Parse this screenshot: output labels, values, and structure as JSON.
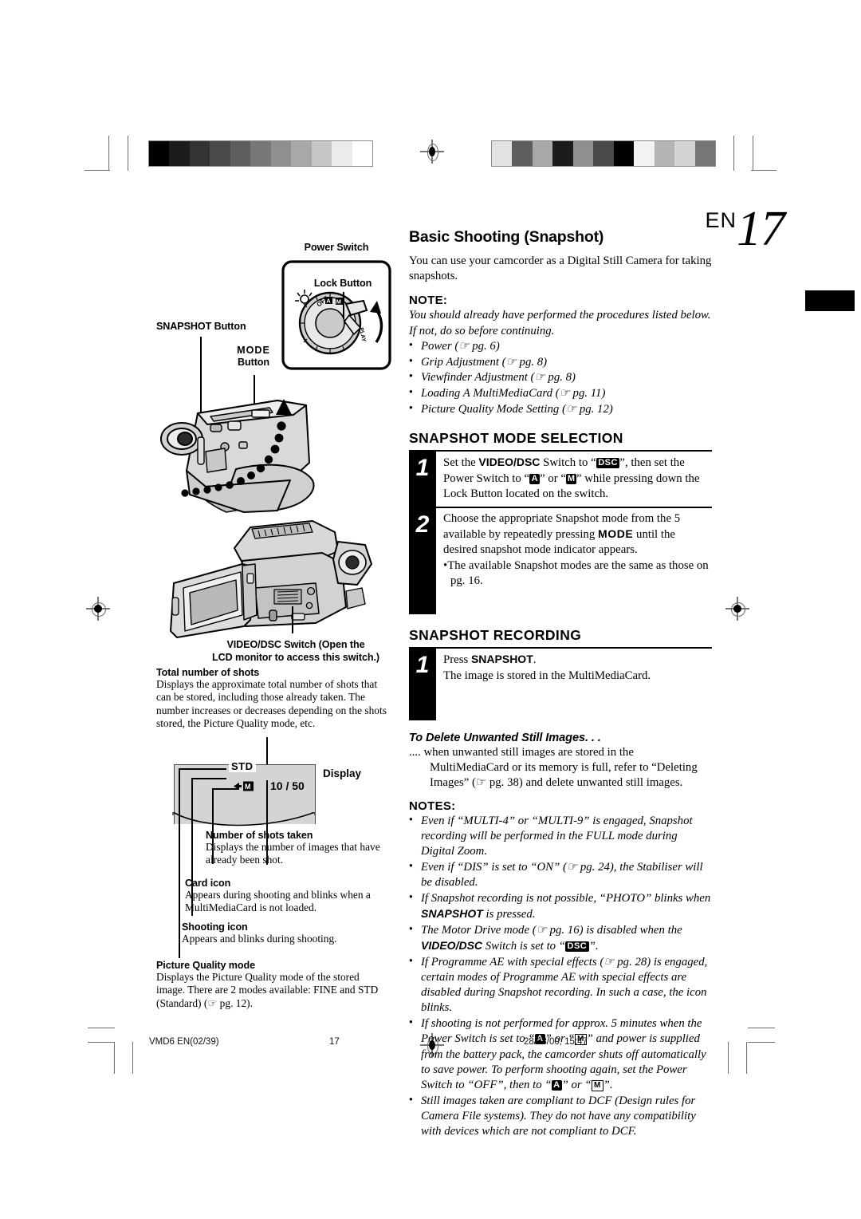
{
  "page": {
    "lang_code": "EN",
    "number": "17"
  },
  "header": {
    "title": "Basic Shooting (Snapshot)",
    "intro": "You can use your camcorder as a Digital Still Camera for taking snapshots."
  },
  "note": {
    "heading": "NOTE:",
    "body": "You should already have performed the procedures listed below. If not, do so before continuing.",
    "items": [
      "Power (☞ pg. 6)",
      "Grip Adjustment (☞ pg. 8)",
      "Viewfinder Adjustment (☞ pg. 8)",
      "Loading A MultiMediaCard (☞ pg. 11)",
      "Picture Quality Mode Setting (☞ pg. 12)"
    ]
  },
  "mode_selection": {
    "heading": "SNAPSHOT MODE SELECTION",
    "steps": [
      {
        "num": "1",
        "text_parts": [
          "Set the ",
          "VIDEO/DSC",
          " Switch to “",
          "DSC",
          "”, then set the Power Switch to “",
          "A",
          "” or “",
          "M",
          "” while pressing down the Lock Button located on the switch."
        ]
      },
      {
        "num": "2",
        "text_parts": [
          "Choose the appropriate Snapshot mode from the 5 available by repeatedly pressing ",
          "MODE",
          " until the desired snapshot mode indicator appears."
        ],
        "sub": "The available Snapshot modes are the same as those on pg. 16."
      }
    ]
  },
  "recording": {
    "heading": "SNAPSHOT RECORDING",
    "steps": [
      {
        "num": "1",
        "line1_pre": "Press ",
        "line1_bold": "SNAPSHOT",
        "line1_post": ".",
        "line2": "The image is stored in the MultiMediaCard."
      }
    ]
  },
  "delete_section": {
    "heading": "To Delete Unwanted Still Images. . .",
    "body": ".... when unwanted still images are stored in the MultiMediaCard or its memory is full, refer to “Deleting Images” (☞ pg. 38) and delete unwanted still images."
  },
  "notes": {
    "heading": "NOTES:",
    "items": [
      "Even if “MULTI-4” or “MULTI-9” is engaged, Snapshot recording will be performed in the FULL mode during Digital Zoom.",
      "Even if “DIS” is set to “ON” (☞ pg. 24), the Stabiliser will be disabled.",
      "If Snapshot recording is not possible, “PHOTO” blinks when SNAPSHOT is pressed.",
      "The Motor Drive mode (☞ pg. 16) is disabled when the VIDEO/DSC Switch is set to “DSC”.",
      "If Programme AE with special effects (☞ pg. 28) is engaged, certain modes of Programme AE with special effects are disabled during Snapshot recording. In such a case, the icon blinks.",
      "If shooting is not performed for approx. 5 minutes when the Power Switch is set to “A” or “M” and power is supplied from the battery pack, the camcorder shuts off automatically to save power. To perform shooting again, set the Power Switch to “OFF”, then to “A” or “M”.",
      "Still images taken are compliant to DCF (Design rules for Camera File systems). They do not have any compatibility with devices which are not compliant to DCF."
    ]
  },
  "illustration_labels": {
    "power_switch": "Power Switch",
    "lock_button": "Lock Button",
    "snapshot_button": "SNAPSHOT Button",
    "mode_button_line1": "MODE",
    "mode_button_line2": "Button",
    "video_dsc_line1": "VIDEO/DSC Switch (Open the",
    "video_dsc_line2": "LCD monitor to access this switch.)",
    "dial_marks": [
      "OFF",
      "A",
      "M",
      "PLAY"
    ]
  },
  "display_callouts": {
    "display_label": "Display",
    "quality_value": "STD",
    "shots_value": "10 / 50",
    "card_glyph": "M",
    "total_shots": {
      "heading": "Total number of shots",
      "body": "Displays the approximate total number of shots that can be stored, including those already taken. The number increases or decreases depending on the shots stored, the Picture Quality mode, etc."
    },
    "shots_taken": {
      "heading": "Number of shots taken",
      "body": "Displays the number of images that have already been shot."
    },
    "card_icon": {
      "heading": "Card icon",
      "body": "Appears during shooting and blinks when a MultiMediaCard is not loaded."
    },
    "shooting_icon": {
      "heading": "Shooting icon",
      "body": "Appears and blinks during shooting."
    },
    "picture_quality": {
      "heading": "Picture Quality mode",
      "body": "Displays the Picture Quality mode of the stored image. There are 2 modes available: FINE and STD (Standard) (☞ pg. 12)."
    }
  },
  "footer": {
    "file": "VMD6 EN(02/39)",
    "page": "17",
    "timestamp": "28/08/00, 15:47"
  },
  "calibration": {
    "left_bar": [
      "#000000",
      "#1c1c1c",
      "#333333",
      "#4a4a4a",
      "#5e5e5e",
      "#787878",
      "#8f8f8f",
      "#a8a8a8",
      "#c6c6c6",
      "#ebebeb",
      "#ffffff"
    ],
    "right_bar": [
      "#e2e2e2",
      "#5e5e5e",
      "#a8a8a8",
      "#1c1c1c",
      "#8f8f8f",
      "#4a4a4a",
      "#000000",
      "#f2f2f2",
      "#b4b4b4",
      "#d4d4d4",
      "#767676"
    ]
  }
}
